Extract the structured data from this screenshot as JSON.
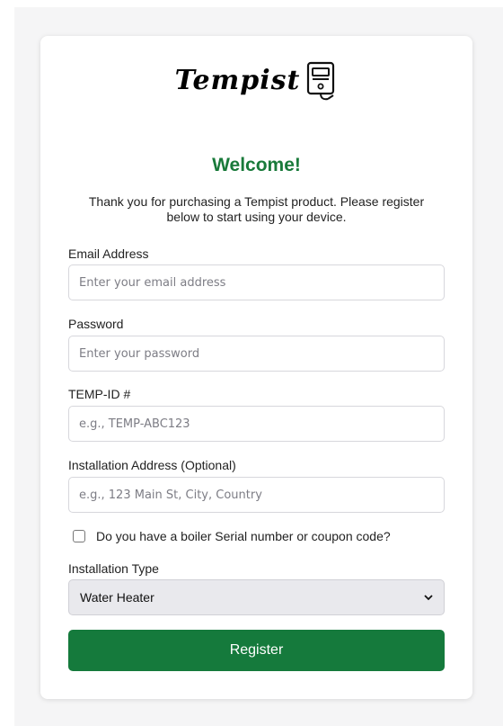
{
  "logo": {
    "text": "Tempist",
    "icon": "thermostat-device-icon"
  },
  "welcome": "Welcome!",
  "intro": "Thank you for purchasing a Tempist product. Please register below to start using your device.",
  "fields": {
    "email": {
      "label": "Email Address",
      "placeholder": "Enter your email address",
      "value": ""
    },
    "password": {
      "label": "Password",
      "placeholder": "Enter your password",
      "value": ""
    },
    "temp_id": {
      "label": "TEMP-ID #",
      "placeholder": "e.g., TEMP-ABC123",
      "value": ""
    },
    "address": {
      "label": "Installation Address (Optional)",
      "placeholder": "e.g., 123 Main St, City, Country",
      "value": ""
    }
  },
  "boiler_checkbox": {
    "label": "Do you have a boiler Serial number or coupon code?",
    "checked": false
  },
  "installation_type": {
    "label": "Installation Type",
    "selected": "Water Heater",
    "icon": "chevron-down-icon"
  },
  "register_button": "Register",
  "colors": {
    "accent": "#157a3c",
    "heading": "#197a3a",
    "background": "#f5f5f6",
    "card": "#ffffff"
  }
}
